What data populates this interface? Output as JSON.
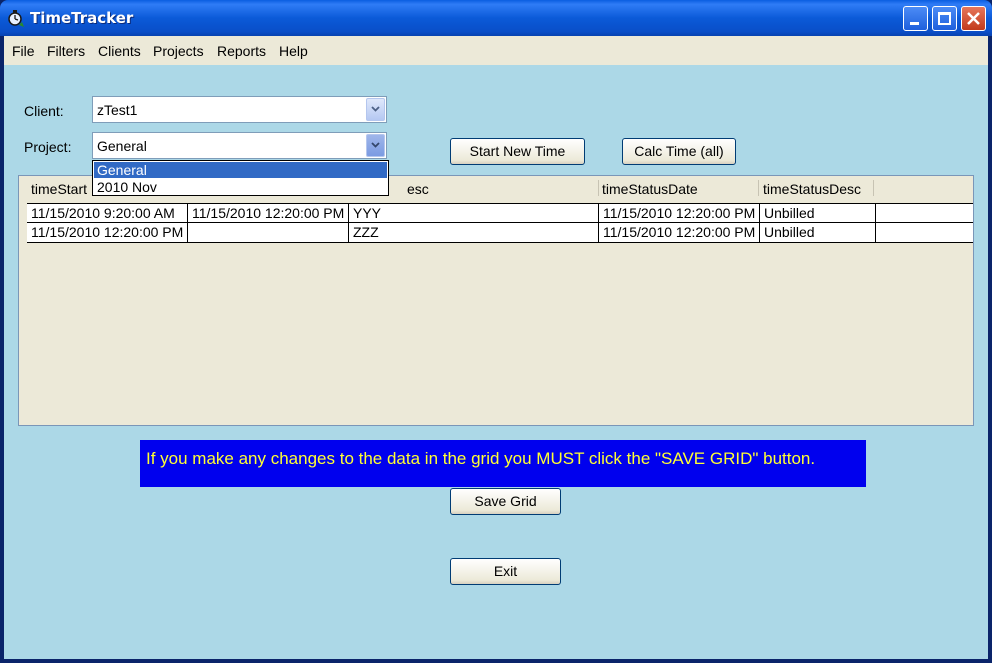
{
  "window": {
    "title": "TimeTracker",
    "icons": {
      "app": "stopwatch-icon",
      "minimize": "minimize-icon",
      "maximize": "maximize-icon",
      "close": "close-icon"
    }
  },
  "menu": [
    "File",
    "Filters",
    "Clients",
    "Projects",
    "Reports",
    "Help"
  ],
  "client": {
    "label": "Client:",
    "value": "zTest1"
  },
  "project": {
    "label": "Project:",
    "value": "General",
    "dropdown_open": true,
    "options": [
      "General",
      "2010 Nov"
    ],
    "highlighted": "General"
  },
  "buttons": {
    "start_new_time": "Start New Time",
    "calc_time": "Calc Time (all)",
    "save_grid": "Save Grid",
    "exit": "Exit"
  },
  "grid": {
    "columns": [
      "timeStart",
      "",
      "esc",
      "timeStatusDate",
      "timeStatusDesc"
    ],
    "rows": [
      [
        "11/15/2010 9:20:00 AM",
        "11/15/2010 12:20:00 PM",
        "YYY",
        "11/15/2010 12:20:00 PM",
        "Unbilled"
      ],
      [
        "11/15/2010 12:20:00 PM",
        "",
        "ZZZ",
        "11/15/2010 12:20:00 PM",
        "Unbilled"
      ]
    ]
  },
  "notice": "If you make any changes to the data in the grid you MUST click the \"SAVE GRID\" button.",
  "colors": {
    "background": "#acd8e7",
    "notice_bg": "#0000ee",
    "notice_text": "#ffff33",
    "titlebar": "#0a5ee0",
    "selection": "#316ac5"
  }
}
